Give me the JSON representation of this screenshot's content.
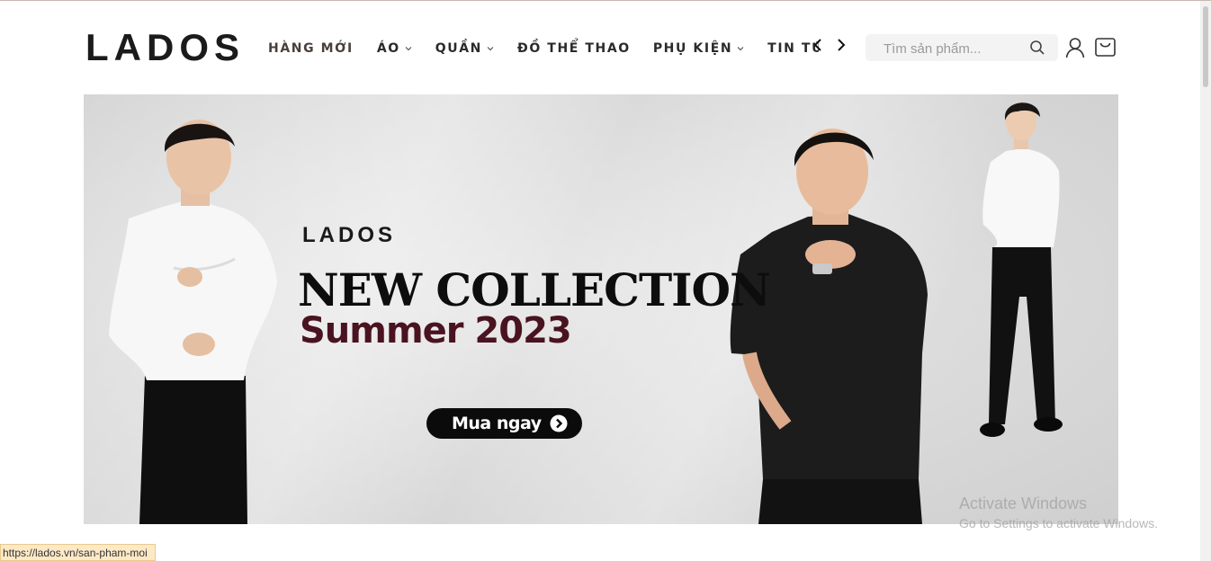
{
  "header": {
    "logo": "LADOS",
    "nav": [
      {
        "label": "HÀNG MỚI",
        "has_dropdown": false
      },
      {
        "label": "ÁO",
        "has_dropdown": true
      },
      {
        "label": "QUẦN",
        "has_dropdown": true
      },
      {
        "label": "ĐỒ THỂ THAO",
        "has_dropdown": false
      },
      {
        "label": "PHỤ KIỆN",
        "has_dropdown": true
      },
      {
        "label": "TIN TỨC",
        "has_dropdown": false
      }
    ],
    "search": {
      "placeholder": "Tìm sản phẩm..."
    },
    "icons": [
      "chevron-left-icon",
      "chevron-right-icon",
      "search-icon",
      "user-icon",
      "cart-icon"
    ]
  },
  "banner": {
    "brand": "LADOS",
    "headline": "NEW COLLECTION",
    "subline": "Summer 2023",
    "cta_label": "Mua ngay",
    "colors": {
      "headline": "#0d0d0d",
      "subline": "#4a1320",
      "cta_bg": "#0b0b0b"
    }
  },
  "watermark": {
    "line1": "Activate Windows",
    "line2": "Go to Settings to activate Windows."
  },
  "status_bar": {
    "url": "https://lados.vn/san-pham-moi"
  }
}
